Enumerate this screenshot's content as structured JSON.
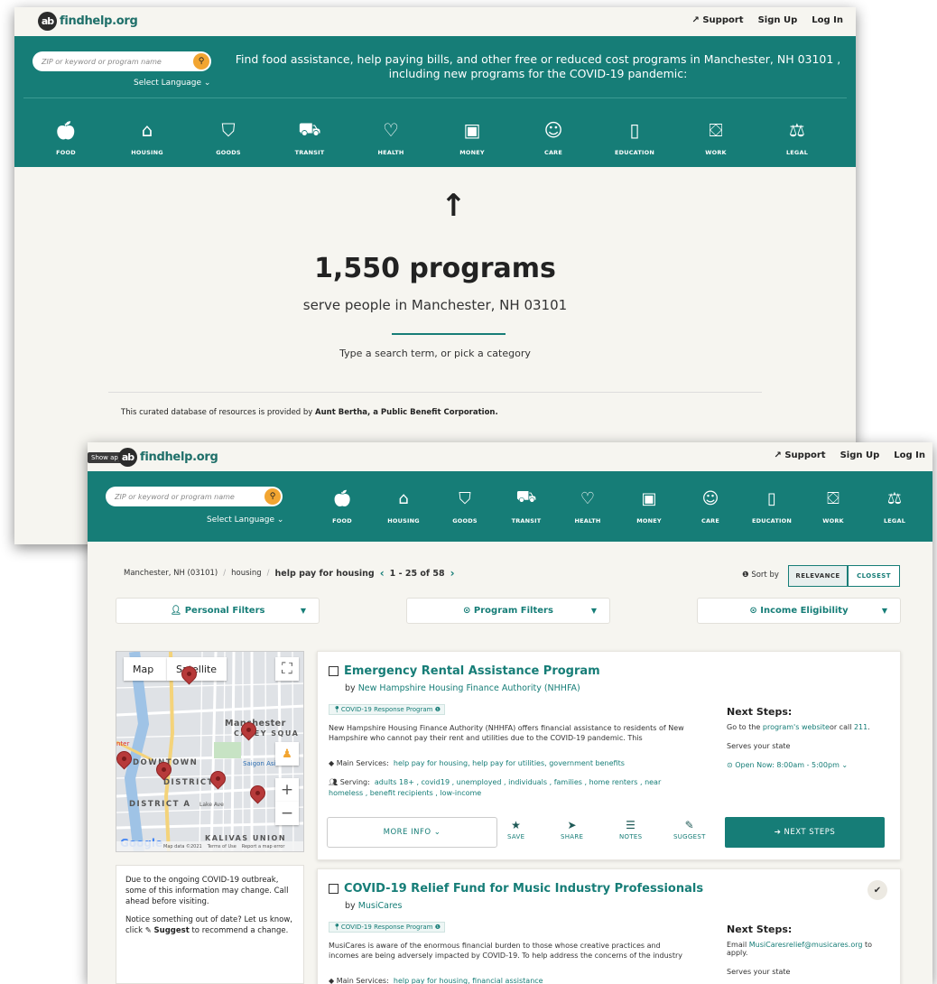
{
  "brand": {
    "logo_mark": "ab",
    "name": "findhelp.org"
  },
  "toplinks": {
    "support": "Support",
    "signup": "Sign Up",
    "login": "Log In"
  },
  "search": {
    "placeholder": "ZIP or keyword or program name",
    "language": "Select Language"
  },
  "header_message": "Find food assistance, help paying bills, and other free or reduced cost programs in Manchester, NH 03101 , including new programs for the COVID-19 pandemic:",
  "categories": [
    "FOOD",
    "HOUSING",
    "GOODS",
    "TRANSIT",
    "HEALTH",
    "MONEY",
    "CARE",
    "EDUCATION",
    "WORK",
    "LEGAL"
  ],
  "landing": {
    "count": "1,550 programs",
    "serve": "serve people in Manchester, NH 03101",
    "hint": "Type a search term, or pick a category",
    "curated_prefix": "This curated database of resources is provided by ",
    "curated_org": "Aunt Bertha, a Public Benefit Corporation."
  },
  "results": {
    "show_apps": "Show apps",
    "breadcrumb": {
      "location": "Manchester, NH (03101)",
      "category": "housing",
      "current": "help pay for housing",
      "range": "1 - 25 of 58"
    },
    "sort": {
      "label": "Sort by",
      "options": [
        "RELEVANCE",
        "CLOSEST"
      ],
      "active": "RELEVANCE"
    },
    "filters": [
      "Personal Filters",
      "Program Filters",
      "Income Eligibility"
    ],
    "map": {
      "tabs": [
        "Map",
        "Satellite"
      ],
      "labels": [
        "Manchester",
        "CAREY SQUA",
        "DOWNTOWN",
        "DISTRICT",
        "DISTRICT A",
        "KALIVAS UNION",
        "Saigon Asian M",
        "Lake Ave",
        "nter"
      ],
      "footer": [
        "Map data ©2021",
        "Terms of Use",
        "Report a map error"
      ],
      "google": "Google"
    },
    "notice": {
      "p1": "Due to the ongoing COVID-19 outbreak, some of this information may change. Call ahead before visiting.",
      "p2_a": "Notice something out of date? Let us know, click ",
      "p2_b": "Suggest",
      "p2_c": " to recommend a change."
    },
    "programs": [
      {
        "title": "Emergency Rental Assistance Program",
        "by_prefix": "by",
        "provider": "New Hampshire Housing Finance Authority (NHHFA)",
        "tag": "COVID-19 Response Program",
        "description": "New Hampshire Housing Finance Authority (NHHFA) offers financial assistance to residents of New Hampshire who cannot pay their rent and utilities due to the COVID-19 pandemic. This",
        "main_services_label": "Main Services:",
        "main_services": "help pay for housing, help pay for utilities, government benefits",
        "serving_label": "Serving:",
        "serving": "adults 18+ , covid19 , unemployed , individuals , families , home renters , near homeless , benefit recipients , low-income",
        "next_steps_title": "Next Steps:",
        "next_a": "Go to the ",
        "next_link": "program's website",
        "next_b": "or call ",
        "next_phone": "211",
        "next_c": ".",
        "serves": "Serves your state",
        "open_label": "Open Now:",
        "open_hours": "8:00am - 5:00pm"
      },
      {
        "title": "COVID-19 Relief Fund for Music Industry Professionals",
        "by_prefix": "by",
        "provider": "MusiCares",
        "tag": "COVID-19 Response Program",
        "description": "MusiCares is aware of the enormous financial burden to those whose creative practices and incomes are being adversely impacted by COVID-19. To help address the concerns of the industry",
        "main_services_label": "Main Services:",
        "main_services": "help pay for housing, financial assistance",
        "next_steps_title": "Next Steps:",
        "next_a": "Email ",
        "next_link": "MusiCaresrelief@musicares.org",
        "next_b": " to apply.",
        "serves": "Serves your state"
      }
    ],
    "actions": {
      "more_info": "MORE INFO",
      "save": "SAVE",
      "share": "SHARE",
      "notes": "NOTES",
      "suggest": "SUGGEST",
      "next_steps": "NEXT STEPS"
    }
  },
  "colors": {
    "teal": "#167d77",
    "accent": "#f2a531",
    "pin": "#b73a3a"
  }
}
